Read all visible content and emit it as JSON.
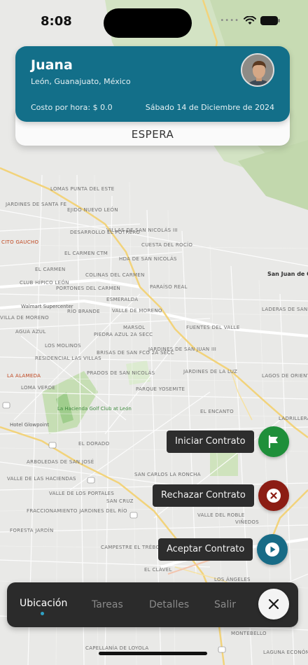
{
  "status_bar": {
    "time": "8:08"
  },
  "card": {
    "name": "Juana",
    "location": "León, Guanajuato, México",
    "cost": "Costo por hora: $ 0.0",
    "date": "Sábado 14 de Diciembre de 2024",
    "status": "ESPERA"
  },
  "actions": {
    "start": {
      "label": "Iniciar Contrato",
      "color": "#1f8f3a",
      "icon": "flag-icon"
    },
    "reject": {
      "label": "Rechazar Contrato",
      "color": "#8c1d14",
      "icon": "close-circle-icon"
    },
    "accept": {
      "label": "Aceptar Contrato",
      "color": "#176b86",
      "icon": "play-icon"
    }
  },
  "nav": {
    "items": [
      {
        "label": "Ubicación",
        "active": true
      },
      {
        "label": "Tareas",
        "active": false
      },
      {
        "label": "Detalles",
        "active": false
      },
      {
        "label": "Salir",
        "active": false
      }
    ],
    "close_icon": "close-icon"
  },
  "map": {
    "labels": [
      "LOMAS PUNTA DEL ESTE",
      "JARDINES DE SANTA FE",
      "EJIDO NUEVO LEÓN",
      "DESARROLLO EL POTRERO",
      "VILLAS DE SAN NICOLÁS III",
      "CUESTA DEL ROCÍO",
      "EL CARMEN CTM",
      "HDA DE SAN NICOLÁS",
      "EL CARMEN",
      "COLINAS DEL CARMEN",
      "San Juan de Otates",
      "CLUB HÍPICO LEÓN",
      "PORTONES DEL CARMEN",
      "ESMERALDA",
      "PARAÍSO REAL",
      "Walmart Supercenter",
      "RÍO BRANDE",
      "VALLE DE MORENO",
      "LADERAS DE SAN JUAN",
      "MARSOL",
      "FUENTES DEL VALLE",
      "AGUA AZUL",
      "PIEDRA AZUL 2A SECC",
      "LOS MOLINOS",
      "JARDINES DE SAN JUAN III",
      "RESIDENCIAL LAS VILLAS",
      "BRISAS DE SAN FCO 2A SECC",
      "PRADOS DE SAN NICOLÁS",
      "JARDINES DE LA LUZ",
      "La Alameda",
      "LAGOS DE ORIENTE",
      "LOMA VERDE",
      "PARQUE YOSEMITE",
      "La Hacienda Golf Club at León",
      "EL ENCANTO",
      "Hotel Glowpoint",
      "LADRILLERAS DEL REFUGIO",
      "EL DORADO",
      "ARBOLEDAS DE SAN JOSÉ",
      "VALLE DE LAS HACIENDAS",
      "SAN CARLOS LA RONCHA",
      "VALLE DE LOS PORTALES",
      "FRACCIONAMIENTO JARDINES DEL RÍO",
      "SAN CRUZ",
      "VALLE DEL ROBLE",
      "VIÑEDOS",
      "FORESTA JARDÍN",
      "CAMPESTRE EL TRÉBOL",
      "EL CLAVEL",
      "LOS ÁNGELES",
      "MONTEBELLO",
      "CAPELLANÍA DE LOYOLA",
      "LAGUNA ECONÓMICAS",
      "CITO GAUCHO",
      "VILLA DE MORENO"
    ]
  }
}
